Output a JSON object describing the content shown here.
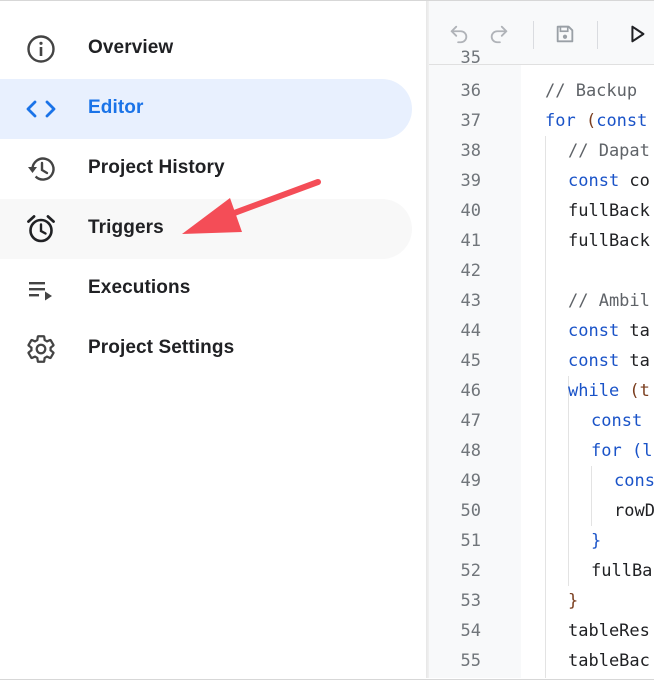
{
  "sidebar": {
    "items": [
      {
        "label": "Overview",
        "icon": "info-icon",
        "state": "normal"
      },
      {
        "label": "Editor",
        "icon": "code-icon",
        "state": "active"
      },
      {
        "label": "Project History",
        "icon": "history-icon",
        "state": "normal"
      },
      {
        "label": "Triggers",
        "icon": "alarm-clock-icon",
        "state": "hover"
      },
      {
        "label": "Executions",
        "icon": "playlist-play-icon",
        "state": "normal"
      },
      {
        "label": "Project Settings",
        "icon": "gear-icon",
        "state": "normal"
      }
    ]
  },
  "toolbar": {
    "buttons": [
      "undo-icon",
      "redo-icon",
      "save-icon",
      "run-icon"
    ]
  },
  "editor": {
    "line_numbers": [
      "36",
      "37",
      "38",
      "39",
      "40",
      "41",
      "42",
      "43",
      "44",
      "45",
      "46",
      "47",
      "48",
      "49",
      "50",
      "51",
      "52",
      "53",
      "54",
      "55"
    ],
    "lines": [
      {
        "tokens": [
          {
            "t": "// Backup",
            "c": "comment"
          }
        ]
      },
      {
        "tokens": [
          {
            "t": "for ",
            "c": "kw"
          },
          {
            "t": "(",
            "c": "paren"
          },
          {
            "t": "const",
            "c": "kw"
          }
        ]
      },
      {
        "tokens": [
          {
            "t": "// Dapat",
            "c": "comment"
          }
        ]
      },
      {
        "tokens": [
          {
            "t": "const ",
            "c": "kw"
          },
          {
            "t": "co",
            "c": "plain"
          }
        ]
      },
      {
        "tokens": [
          {
            "t": "fullBack",
            "c": "plain"
          }
        ]
      },
      {
        "tokens": [
          {
            "t": "fullBack",
            "c": "plain"
          }
        ]
      },
      {
        "tokens": []
      },
      {
        "tokens": [
          {
            "t": "// Ambil",
            "c": "comment"
          }
        ]
      },
      {
        "tokens": [
          {
            "t": "const ",
            "c": "kw"
          },
          {
            "t": "ta",
            "c": "plain"
          }
        ]
      },
      {
        "tokens": [
          {
            "t": "const ",
            "c": "kw"
          },
          {
            "t": "ta",
            "c": "plain"
          }
        ]
      },
      {
        "tokens": [
          {
            "t": "while ",
            "c": "kw"
          },
          {
            "t": "(t",
            "c": "paren"
          }
        ]
      },
      {
        "tokens": [
          {
            "t": "const",
            "c": "kw"
          }
        ]
      },
      {
        "tokens": [
          {
            "t": "for ",
            "c": "kw"
          },
          {
            "t": "(l",
            "c": "kw"
          }
        ]
      },
      {
        "tokens": [
          {
            "t": "cons",
            "c": "kw"
          }
        ]
      },
      {
        "tokens": [
          {
            "t": "rowD",
            "c": "plain"
          }
        ]
      },
      {
        "tokens": [
          {
            "t": "}",
            "c": "kw"
          }
        ]
      },
      {
        "tokens": [
          {
            "t": "fullBa",
            "c": "plain"
          }
        ]
      },
      {
        "tokens": [
          {
            "t": "}",
            "c": "paren"
          }
        ]
      },
      {
        "tokens": [
          {
            "t": "tableRes",
            "c": "plain"
          }
        ]
      },
      {
        "tokens": [
          {
            "t": "tableBac",
            "c": "plain"
          }
        ]
      }
    ],
    "partial_top_line": "35"
  },
  "colors": {
    "active_bg": "#e8f0fe",
    "active_text": "#1a73e8",
    "arrow": "#f44d57"
  }
}
